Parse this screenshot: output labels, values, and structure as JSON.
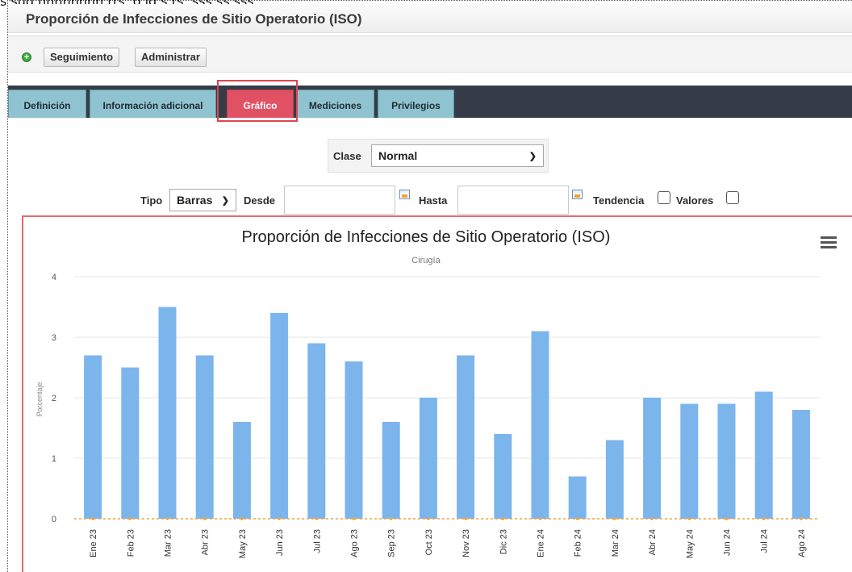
{
  "caption": "s sug  nnnnnnnn rts, o ig  s  rs,  sss ss  sss",
  "app": {
    "title": "Proporción de Infecciones de Sitio Operatorio (ISO)"
  },
  "toolbar": {
    "add_icon": "plus-circle-icon",
    "buttons": [
      "Seguimiento",
      "Administrar"
    ]
  },
  "tabs": [
    {
      "label": "Definición",
      "active": false
    },
    {
      "label": "Información adicional",
      "active": false
    },
    {
      "label": "Gráfico",
      "active": true
    },
    {
      "label": "Mediciones",
      "active": false
    },
    {
      "label": "Privilegios",
      "active": false
    }
  ],
  "filters": {
    "clase_label": "Clase",
    "clase_value": "Normal",
    "tipo_label": "Tipo",
    "tipo_value": "Barras",
    "desde_label": "Desde",
    "desde_value": "",
    "hasta_label": "Hasta",
    "hasta_value": "",
    "tendencia_label": "Tendencia",
    "tendencia_checked": false,
    "valores_label": "Valores",
    "valores_checked": false
  },
  "colors": {
    "bar": "#7cb5ec",
    "highlight": "#e0454f",
    "tab_active": "#e05164",
    "tab": "#8fc3cf",
    "tabbar": "#343d47",
    "baseline": "#f0a23b"
  },
  "chart_data": {
    "type": "bar",
    "title": "Proporción de Infecciones de Sitio Operatorio (ISO)",
    "subtitle": "Cirugía",
    "xlabel": "",
    "ylabel": "Porcentaje",
    "ylim": [
      0,
      4
    ],
    "yticks": [
      0,
      1,
      2,
      3,
      4
    ],
    "grid": true,
    "categories": [
      "Ene 23",
      "Feb 23",
      "Mar 23",
      "Abr 23",
      "May 23",
      "Jun 23",
      "Jul 23",
      "Ago 23",
      "Sep 23",
      "Oct 23",
      "Nov 23",
      "Dic 23",
      "Ene 24",
      "Feb 24",
      "Mar 24",
      "Abr 24",
      "May 24",
      "Jun 24",
      "Jul 24",
      "Ago 24"
    ],
    "values": [
      2.7,
      2.5,
      3.5,
      2.7,
      1.6,
      3.4,
      2.9,
      2.6,
      1.6,
      2.0,
      2.7,
      1.4,
      3.1,
      0.7,
      1.3,
      2.0,
      1.9,
      1.9,
      2.1,
      1.8
    ]
  }
}
